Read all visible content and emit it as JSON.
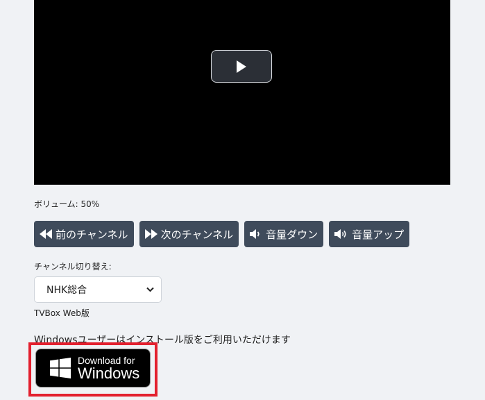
{
  "player": {
    "play_icon": "play-icon"
  },
  "volume": {
    "text": "ボリューム: 50%"
  },
  "controls": {
    "prev_channel": {
      "label": "前のチャンネル",
      "icon": "backward-icon"
    },
    "next_channel": {
      "label": "次のチャンネル",
      "icon": "forward-icon"
    },
    "volume_down": {
      "label": "音量ダウン",
      "icon": "volume-down-icon"
    },
    "volume_up": {
      "label": "音量アップ",
      "icon": "volume-up-icon"
    }
  },
  "channel": {
    "label": "チャンネル切り替え:",
    "selected": "NHK総合"
  },
  "version": {
    "text": "TVBox Web版"
  },
  "notice": {
    "text": "Windowsユーザーはインストール版をご利用いただけます"
  },
  "download": {
    "line1": "Download for",
    "line2": "Windows",
    "icon": "windows-logo-icon"
  },
  "colors": {
    "background": "#f0f2f5",
    "button": "#3f4b5b",
    "highlight": "#e3202e"
  }
}
